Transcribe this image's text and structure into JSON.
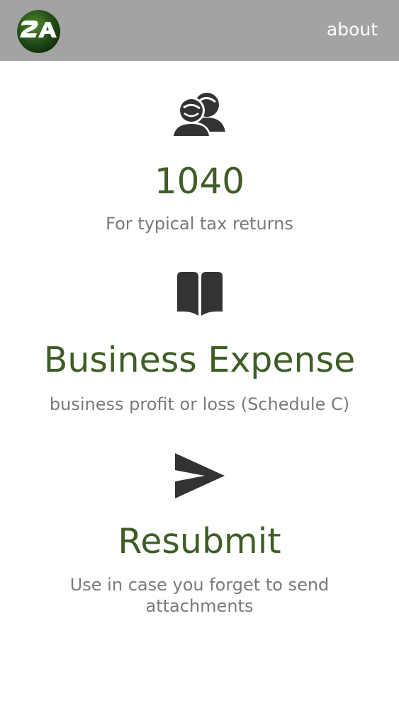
{
  "header": {
    "logo_text": "2A",
    "about_label": "about"
  },
  "options": [
    {
      "title": "1040",
      "description": "For typical tax returns",
      "icon": "users-icon"
    },
    {
      "title": "Business Expense",
      "description": "business profit or loss (Schedule C)",
      "icon": "book-icon"
    },
    {
      "title": "Resubmit",
      "description": "Use in case you forget to send attachments",
      "icon": "send-icon"
    }
  ],
  "colors": {
    "header_bg": "#a3a3a3",
    "title_green": "#3f5d26",
    "description_gray": "#7a7a7a",
    "icon_dark": "#333333"
  }
}
